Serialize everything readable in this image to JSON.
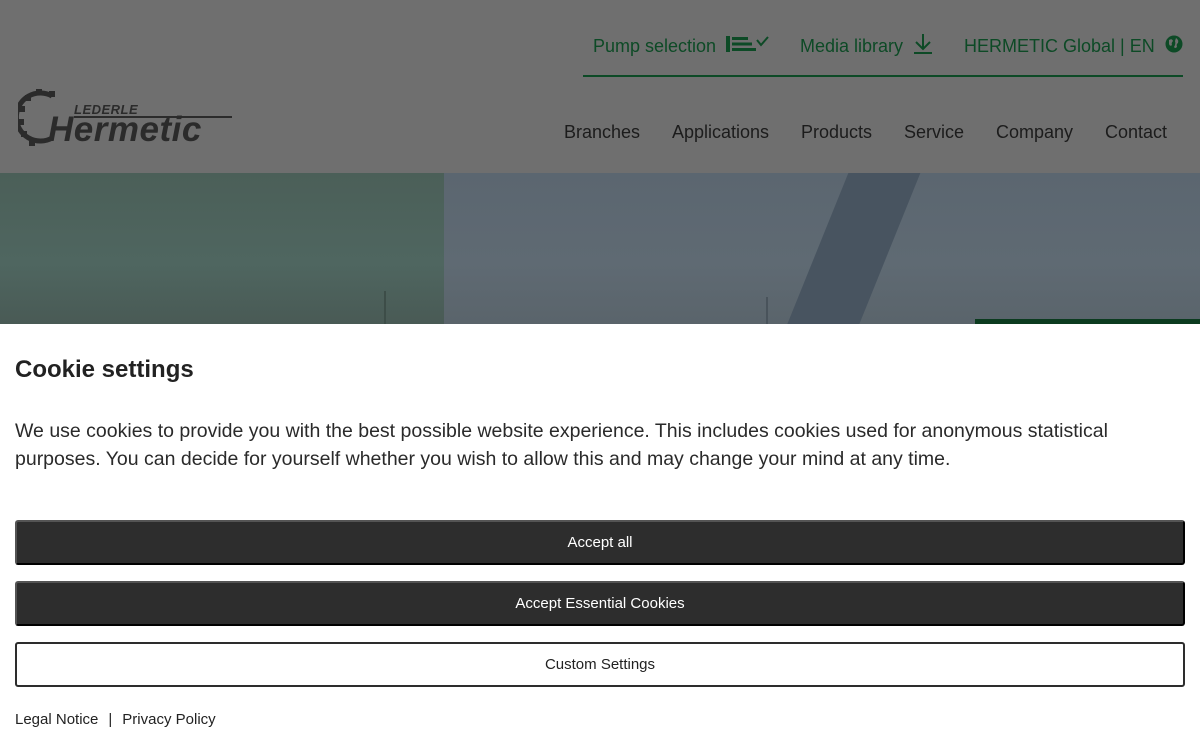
{
  "brand": {
    "logo_small": "LEDERLE",
    "logo_big": "Hermetic"
  },
  "topnav": {
    "pump_selection": "Pump selection",
    "media_library": "Media library",
    "global": "HERMETIC Global | EN"
  },
  "mainnav": [
    "Branches",
    "Applications",
    "Products",
    "Service",
    "Company",
    "Contact"
  ],
  "cookie": {
    "title": "Cookie settings",
    "text": "We use cookies to provide you with the best possible website experience. This includes cookies used for anonymous statistical purposes. You can decide for yourself whether you wish to allow this and may change your mind at any time.",
    "accept_all": "Accept all",
    "accept_essential": "Accept Essential Cookies",
    "custom": "Custom Settings",
    "legal": "Legal Notice",
    "separator": "|",
    "privacy": "Privacy Policy"
  },
  "colors": {
    "brand_green": "#0d4a26",
    "button_dark": "#2d2d2d"
  },
  "icons": {
    "pump_selection": "list-chevron-icon",
    "media_library": "download-icon",
    "global": "globe-icon"
  }
}
